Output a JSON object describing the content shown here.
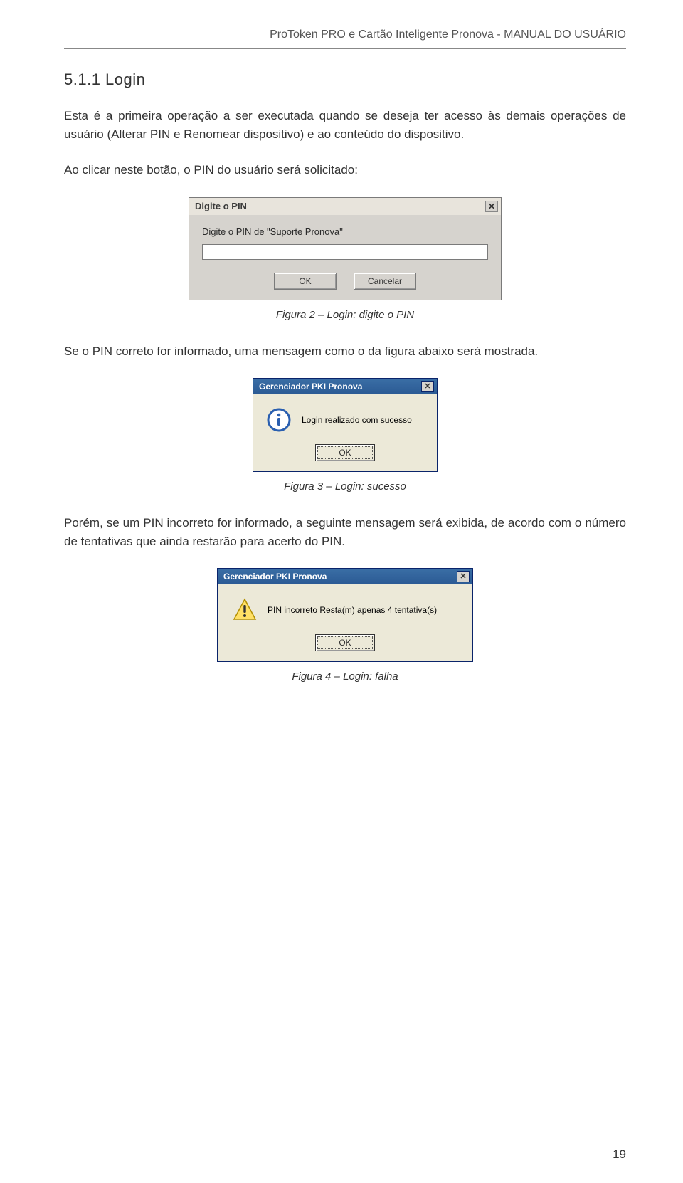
{
  "header": "ProToken PRO e Cartão Inteligente Pronova - MANUAL DO USUÁRIO",
  "section_heading": "5.1.1 Login",
  "para1": "Esta é a primeira operação a ser executada quando se deseja ter acesso às demais operações de usuário (Alterar PIN e Renomear dispositivo) e ao conteúdo do dispositivo.",
  "para2": "Ao clicar neste botão, o PIN do usuário será solicitado:",
  "dialog1": {
    "title": "Digite o PIN",
    "label": "Digite o PIN de  \"Suporte Pronova\"",
    "ok": "OK",
    "cancel": "Cancelar"
  },
  "caption1": "Figura 2 – Login: digite o PIN",
  "para3": "Se o PIN correto for informado, uma mensagem como o da figura abaixo será mostrada.",
  "dialog2": {
    "title": "Gerenciador PKI Pronova",
    "msg": "Login realizado com sucesso",
    "ok": "OK"
  },
  "caption2": "Figura 3 – Login: sucesso",
  "para4": "Porém, se um PIN incorreto for informado, a seguinte mensagem será exibida, de acordo com o número de tentativas que ainda restarão para acerto do PIN.",
  "dialog3": {
    "title": "Gerenciador PKI Pronova",
    "msg": "PIN incorreto Resta(m) apenas 4 tentativa(s)",
    "ok": "OK"
  },
  "caption3": "Figura 4 – Login: falha",
  "page_number": "19"
}
